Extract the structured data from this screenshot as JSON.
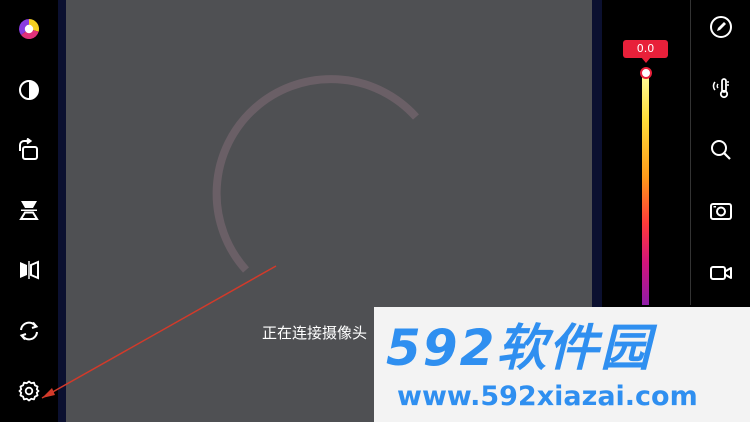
{
  "status": {
    "connecting_text": "正在连接摄像头"
  },
  "temperature": {
    "value": "0.0"
  },
  "watermark": {
    "logo": "592软件园",
    "url": "www.592xiazai.com"
  },
  "left_toolbar": {
    "items": [
      "palette-icon",
      "contrast-icon",
      "rotate-icon",
      "mirror-vertical-icon",
      "mirror-horizontal-icon",
      "refresh-icon",
      "settings-icon"
    ]
  },
  "right_toolbar": {
    "items": [
      "edit-icon",
      "temperature-icon",
      "search-icon",
      "photo-camera-icon",
      "video-camera-icon"
    ]
  },
  "colors": {
    "badge": "#e8203a",
    "viewport": "#4f5053",
    "spinner": "#6a5f66",
    "watermark": "#2f8ff0"
  }
}
